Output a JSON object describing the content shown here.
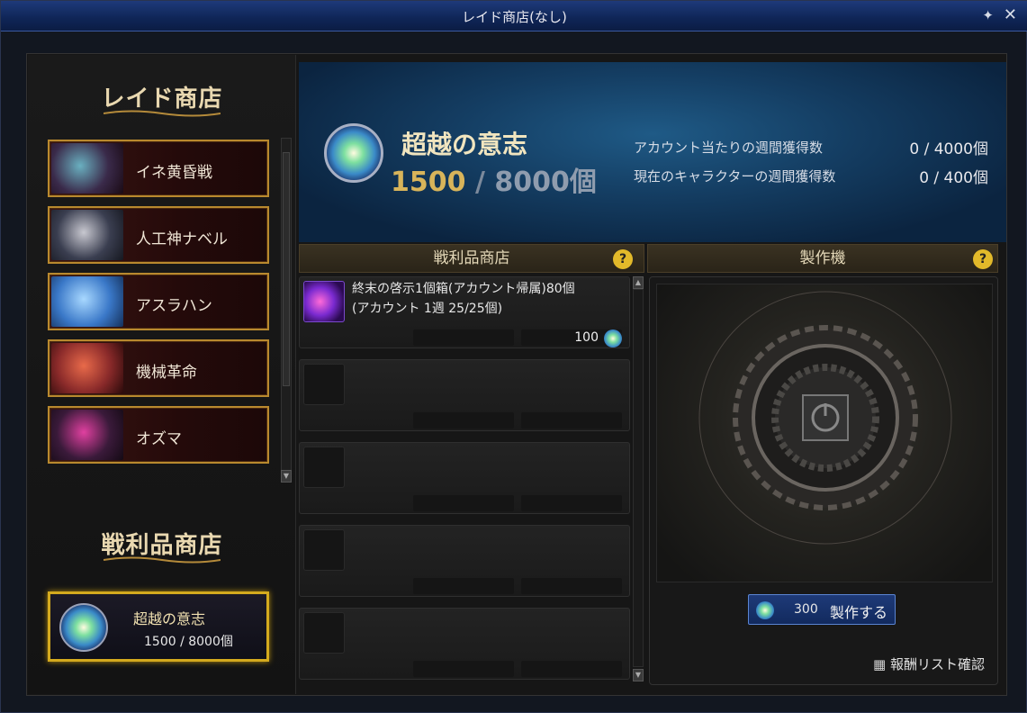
{
  "window": {
    "title": "レイド商店(なし)",
    "pin_icon": "pin-icon",
    "close_icon": "close-icon"
  },
  "left": {
    "raid_title": "レイド商店",
    "raids": [
      {
        "label": "イネ黄昏戦",
        "color": "#4a7a9a"
      },
      {
        "label": "人工神ナベル",
        "color": "#5a6a7a"
      },
      {
        "label": "アスラハン",
        "color": "#4aa0e0"
      },
      {
        "label": "機械革命",
        "color": "#c04a3a"
      },
      {
        "label": "オズマ",
        "color": "#6a3a8a"
      }
    ],
    "loot_title": "戦利品商店",
    "currency": {
      "name": "超越の意志",
      "count": "1500 / 8000個"
    }
  },
  "banner": {
    "currency_name": "超越の意志",
    "current": "1500",
    "slash": "/",
    "max": "8000個",
    "account_label": "アカウント当たりの週間獲得数",
    "account_value": "0 / 4000個",
    "character_label": "現在のキャラクターの週間獲得数",
    "character_value": "0 /  400個"
  },
  "shop": {
    "title": "戦利品商店",
    "help": "?",
    "items": [
      {
        "line1": "終末の啓示1個箱(アカウント帰属)80個",
        "line2": "(アカウント 1週 25/25個)",
        "price": "100"
      }
    ]
  },
  "craft": {
    "title": "製作機",
    "help": "?",
    "cost": "300",
    "button_label": "製作する",
    "reward_link": "報酬リスト確認"
  }
}
